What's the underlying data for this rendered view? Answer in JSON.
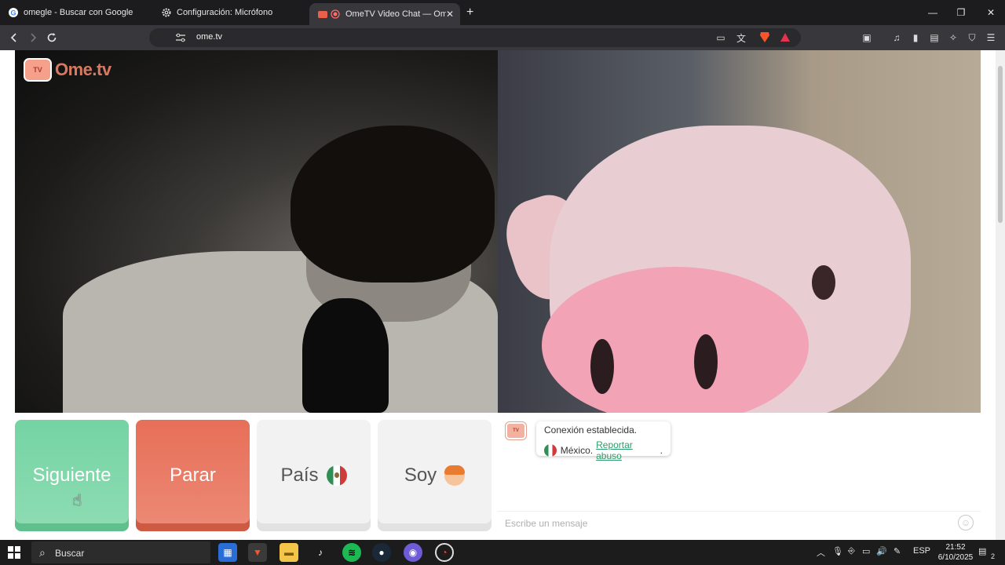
{
  "browser": {
    "tabs": [
      {
        "title": "omegle - Buscar con Google",
        "icon": "google-icon"
      },
      {
        "title": "Configuración: Micrófono",
        "icon": "gear-icon"
      },
      {
        "title": "OmeTV Video Chat — Omegl",
        "icon": "ometv-icon",
        "active": true
      }
    ],
    "url": "ome.tv"
  },
  "site": {
    "logo_text": "Ome.tv",
    "logo_badge": "Ome\nTV",
    "buttons": {
      "next": "Siguiente",
      "stop": "Parar",
      "country": "País",
      "gender": "Soy"
    },
    "chat": {
      "system_line1": "Conexión establecida.",
      "country_name": "México.",
      "report_link": "Reportar abuso",
      "report_suffix": ".",
      "input_placeholder": "Escribe un mensaje"
    }
  },
  "taskbar": {
    "search_label": "Buscar",
    "language": "ESP",
    "time": "21:52",
    "date": "6/10/2025",
    "notification_count": "2"
  },
  "colors": {
    "next_button": "#74d4a3",
    "stop_button": "#e76f58",
    "link_green": "#2e9c6a"
  }
}
